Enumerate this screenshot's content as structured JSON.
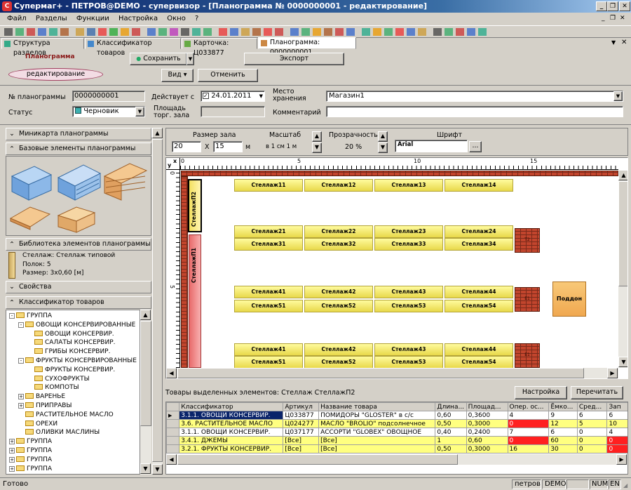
{
  "window": {
    "title": "Супермаг+ - ПЕТРОВ@DEMO - супервизор - [Планограмма № 0000000001 - редактирование]"
  },
  "menu": [
    "Файл",
    "Разделы",
    "Функции",
    "Настройка",
    "Окно",
    "?"
  ],
  "tabs": [
    {
      "label": "Структура разделов"
    },
    {
      "label": "Классификатор товаров"
    },
    {
      "label": "Карточка: Ц033877"
    },
    {
      "label": "Планограмма: 0000000001"
    }
  ],
  "header": {
    "doc_title": "Планограмма",
    "mode": "редактирование",
    "save": "Сохранить",
    "export": "Экспорт",
    "view": "Вид",
    "cancel": "Отменить"
  },
  "form": {
    "number_label": "№ планограммы",
    "number_value": "0000000001",
    "valid_label": "Действует с",
    "valid_value": "24.01.2011",
    "storage_label": "Место\nхранения",
    "storage_value": "Магазин1",
    "status_label": "Статус",
    "status_value": "Черновик",
    "area_label": "Площадь\nторг. зала",
    "area_value": "",
    "comment_label": "Комментарий",
    "comment_value": ""
  },
  "left": {
    "minimap": "Миникарта планограммы",
    "base_elements": "Базовые элементы планограммы",
    "library": "Библиотека элементов планограммы",
    "library_item": [
      "Стеллаж: Стеллаж типовой",
      "Полок: 5",
      "Размер: 3x0,60 [м]"
    ],
    "properties": "Свойства",
    "classifier": "Классификатор товаров",
    "tree": [
      {
        "label": "ГРУППА",
        "level": 0,
        "expander": "-"
      },
      {
        "label": "ОВОЩИ КОНСЕРВИРОВАННЫЕ",
        "level": 1,
        "expander": "-"
      },
      {
        "label": "ОВОЩИ КОНСЕРВИР.",
        "level": 2,
        "expander": ""
      },
      {
        "label": "САЛАТЫ КОНСЕРВИР.",
        "level": 2,
        "expander": ""
      },
      {
        "label": "ГРИБЫ КОНСЕРВИР.",
        "level": 2,
        "expander": ""
      },
      {
        "label": "ФРУКТЫ КОНСЕРВИРОВАННЫЕ",
        "level": 1,
        "expander": "-"
      },
      {
        "label": "ФРУКТЫ КОНСЕРВИР.",
        "level": 2,
        "expander": ""
      },
      {
        "label": "СУХОФРУКТЫ",
        "level": 2,
        "expander": ""
      },
      {
        "label": "КОМПОТЫ",
        "level": 2,
        "expander": ""
      },
      {
        "label": "ВАРЕНЬЕ",
        "level": 1,
        "expander": "+"
      },
      {
        "label": "ПРИПРАВЫ",
        "level": 1,
        "expander": "+"
      },
      {
        "label": "РАСТИТЕЛЬНОЕ МАСЛО",
        "level": 1,
        "expander": ""
      },
      {
        "label": "ОРЕХИ",
        "level": 1,
        "expander": ""
      },
      {
        "label": "ОЛИВКИ МАСЛИНЫ",
        "level": 1,
        "expander": ""
      },
      {
        "label": "ГРУППА",
        "level": 0,
        "expander": "+"
      },
      {
        "label": "ГРУППА",
        "level": 0,
        "expander": "+"
      },
      {
        "label": "ГРУППА",
        "level": 0,
        "expander": "+"
      },
      {
        "label": "ГРУППА",
        "level": 0,
        "expander": "+"
      }
    ]
  },
  "toolbar2": {
    "room_size_label": "Размер зала",
    "room_w": "20",
    "x_sep": "X",
    "room_h": "15",
    "unit": "м",
    "scale_label": "Масштаб",
    "scale_value": "в 1 см 1 м",
    "transparency_label": "Прозрачность",
    "transparency_value": "20 %",
    "font_label": "Шрифт",
    "font_value": "Arial",
    "font_btn": "..."
  },
  "ruler": {
    "top": [
      "0",
      "5",
      "10",
      "15"
    ],
    "side": [
      "0",
      "5"
    ],
    "corner_x": "x",
    "corner_y": "y"
  },
  "canvas": {
    "rows": [
      [
        "Стеллаж11",
        "Стеллаж12",
        "Стеллаж13",
        "Стеллаж14"
      ],
      [
        "Стеллаж21",
        "Стеллаж22",
        "Стеллаж23",
        "Стеллаж24"
      ],
      [
        "Стеллаж31",
        "Стеллаж32",
        "Стеллаж33",
        "Стеллаж34"
      ],
      [
        "Стеллаж41",
        "Стеллаж42",
        "Стеллаж43",
        "Стеллаж44"
      ],
      [
        "Стеллаж51",
        "Стеллаж52",
        "Стеллаж53",
        "Стеллаж54"
      ],
      [
        "Стеллаж41",
        "Стеллаж42",
        "Стеллаж43",
        "Стеллаж44"
      ],
      [
        "Стеллаж51",
        "Стеллаж52",
        "Стеллаж53",
        "Стеллаж54"
      ]
    ],
    "vertical_shelves": [
      "СтеллажП2",
      "СтеллажП1"
    ],
    "walls": [
      "T2",
      "E1",
      "E1"
    ],
    "pallet": "Поддон"
  },
  "bottom": {
    "caption": "Товары выделенных элементов: Стеллаж СтеллажП2",
    "settings": "Настройка",
    "recalc": "Перечитать",
    "columns": [
      "Классификатор",
      "Артикул",
      "Название товара",
      "Длина...",
      "Площад...",
      "Опер. ос...",
      "Ёмко...",
      "Сред...",
      "Зап"
    ],
    "rows": [
      [
        "3.1.1. ОВОЩИ КОНСЕРВИР.",
        "Ц033877",
        "ПОМИДОРЫ \"GLOSTER\" в с/с",
        "0,60",
        "0,3600",
        "4",
        "9",
        "6",
        "6"
      ],
      [
        "3.6. РАСТИТЕЛЬНОЕ МАСЛО",
        "Ц024277",
        "МАСЛО \"BROLIO\" подсолнечное",
        "0,50",
        "0,3000",
        "0",
        "12",
        "5",
        "10"
      ],
      [
        "3.1.1. ОВОЩИ КОНСЕРВИР.",
        "Ц037177",
        "АССОРТИ \"GLOBEX\" ОВОЩНОЕ",
        "0,40",
        "0,2400",
        "7",
        "6",
        "0",
        "4"
      ],
      [
        "3.4.1. ДЖЕМЫ",
        "[Все]",
        "[Все]",
        "1",
        "0,60",
        "0",
        "60",
        "0",
        "0"
      ],
      [
        "3.2.1. ФРУКТЫ КОНСЕРВИР.",
        "[Все]",
        "[Все]",
        "0,50",
        "0,3000",
        "16",
        "30",
        "0",
        "0"
      ]
    ]
  },
  "status": {
    "left": "Готово",
    "user": "петров",
    "db": "DEMO",
    "num": "NUM",
    "lang": "EN"
  },
  "colors": {
    "title_from": "#0a246a",
    "title_to": "#a6caf0",
    "selection": "#0a246a",
    "shelf": "#f4ec6a",
    "wall": "#c2452d",
    "pallet": "#f4b860",
    "row_yellow": "#ffff80",
    "cell_red": "#ff2020"
  }
}
